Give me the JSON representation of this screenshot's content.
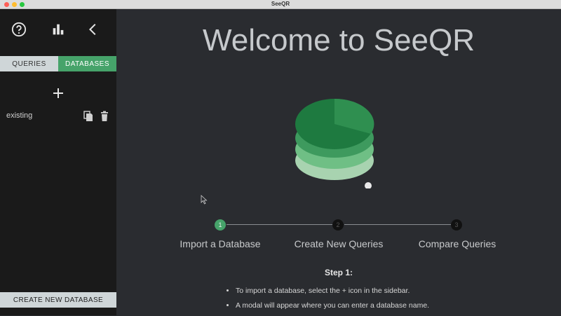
{
  "window": {
    "title": "SeeQR"
  },
  "sidebar": {
    "icons": {
      "help": "help-circle-icon",
      "stats": "bar-chart-icon",
      "collapse": "chevron-left-icon"
    },
    "tabs": [
      {
        "label": "QUERIES",
        "selected": false
      },
      {
        "label": "DATABASES",
        "selected": true
      }
    ],
    "databases": [
      {
        "name": "existing"
      }
    ],
    "create_button": "CREATE NEW DATABASE"
  },
  "main": {
    "heading": "Welcome to SeeQR",
    "steps": [
      {
        "number": "1",
        "label": "Import a Database",
        "active": true
      },
      {
        "number": "2",
        "label": "Create New Queries",
        "active": false
      },
      {
        "number": "3",
        "label": "Compare Queries",
        "active": false
      }
    ],
    "step_title": "Step 1:",
    "instructions": [
      "To import a database, select the + icon in the sidebar.",
      "A modal will appear where you can enter a database name."
    ]
  },
  "colors": {
    "accent": "#46a36a",
    "background": "#2a2c30",
    "sidebar": "#1a1a1a"
  }
}
